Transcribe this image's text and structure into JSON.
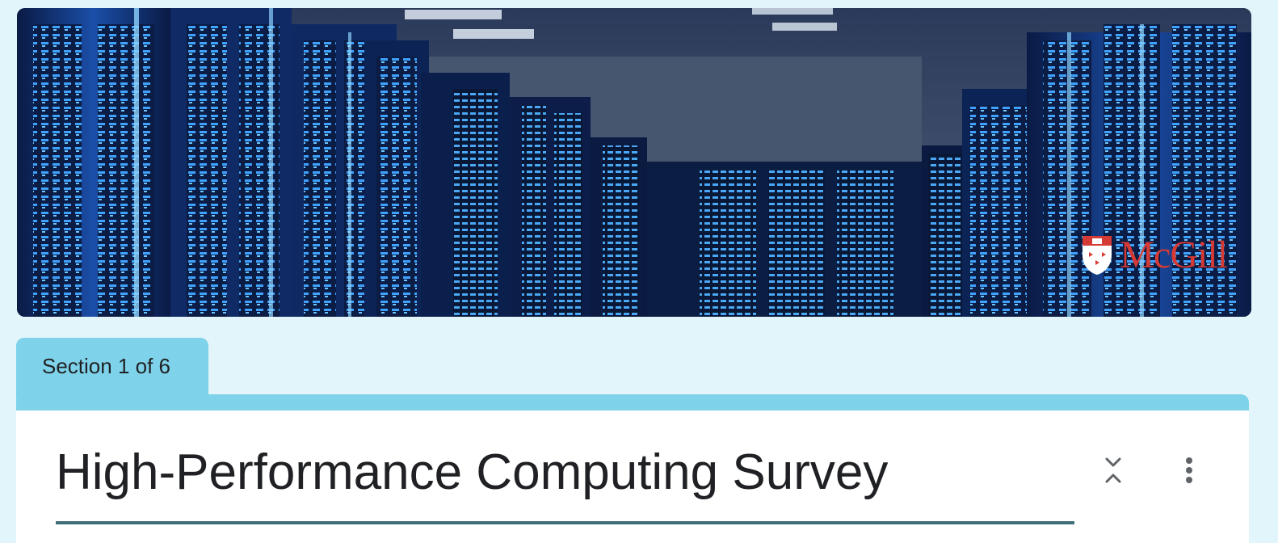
{
  "header": {
    "banner_image": "server-room-photo",
    "logo": {
      "text": "McGill",
      "color": "#d63a34"
    }
  },
  "section": {
    "label": "Section 1 of 6"
  },
  "form": {
    "title": "High-Performance Computing Survey"
  },
  "toolbar": {
    "collapse_icon": "collapse-icon",
    "more_icon": "more-vert-icon"
  },
  "colors": {
    "page_background": "#e2f5fa",
    "accent": "#7ed3ea",
    "title_underline": "#3f6e78",
    "card_background": "#ffffff"
  }
}
